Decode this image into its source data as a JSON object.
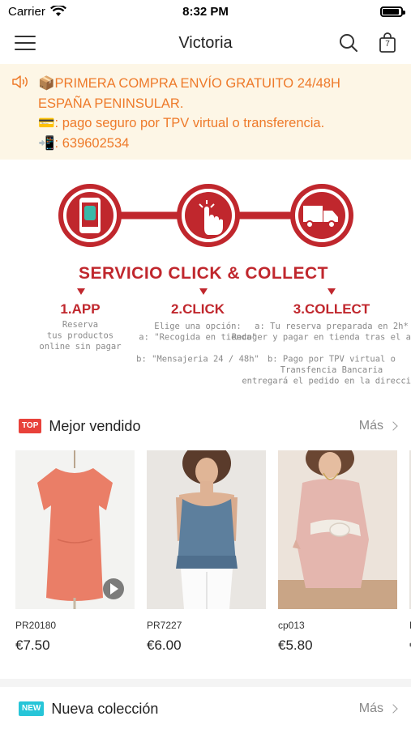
{
  "status_bar": {
    "carrier": "Carrier",
    "time": "8:32 PM",
    "battery_level": 0.9
  },
  "nav": {
    "title": "Victoria",
    "cart_count": "7"
  },
  "announcement": {
    "lines": [
      {
        "emoji": "📦",
        "text": "PRIMERA COMPRA ENVÍO GRATUITO 24/48H"
      },
      {
        "emoji": "",
        "text": "ESPAÑA PENINSULAR."
      },
      {
        "emoji": "💳",
        "text": ": pago seguro por TPV virtual o transferencia."
      },
      {
        "emoji": "📲",
        "text": ": 639602534"
      }
    ]
  },
  "banner": {
    "title": "SERVICIO CLICK & COLLECT",
    "accent_color": "#c0272d",
    "steps": [
      {
        "heading": "1.APP",
        "lines": [
          "Reserva",
          "tus productos",
          "online sin pagar"
        ]
      },
      {
        "heading": "2.CLICK",
        "lines": [
          "Elige una opción:",
          "a: \"Recogida en tienda\"",
          "",
          "b: \"Mensajeria 24 / 48h\""
        ]
      },
      {
        "heading": "3.COLLECT",
        "lines": [
          "a: Tu reserva preparada en 2h*",
          "Recoger y pagar en tienda tras el aviso",
          "",
          "b: Pago por TPV virtual o",
          "Transfencia Bancaria",
          "entregará el pedido en la dirección"
        ]
      }
    ]
  },
  "best_sellers": {
    "badge": "TOP",
    "title": "Mejor vendido",
    "more": "Más",
    "products": [
      {
        "code": "PR20180",
        "price": "€7.50"
      },
      {
        "code": "PR7227",
        "price": "€6.00"
      },
      {
        "code": "cp013",
        "price": "€5.80"
      },
      {
        "code": "P",
        "price": "€"
      }
    ]
  },
  "new_collection": {
    "badge": "NEW",
    "title": "Nueva colección",
    "more": "Más"
  }
}
